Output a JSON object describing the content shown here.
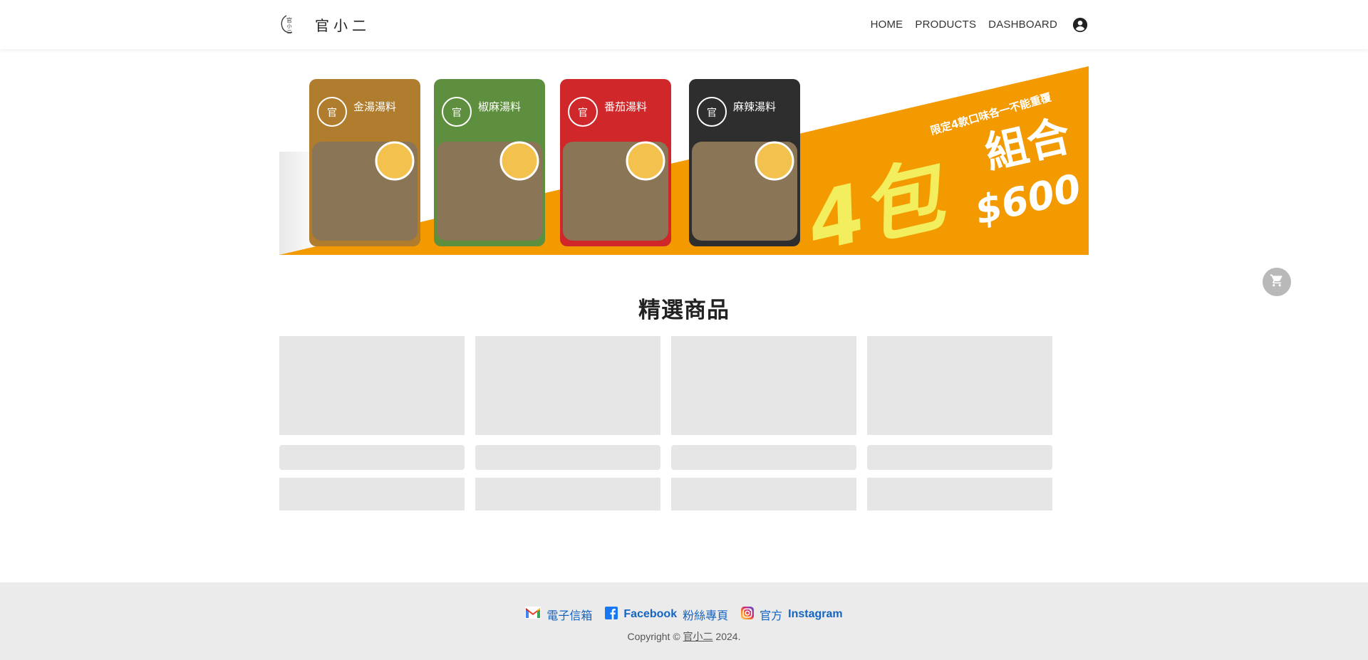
{
  "header": {
    "brand_name": "官小二",
    "nav": [
      "HOME",
      "PRODUCTS",
      "DASHBOARD"
    ],
    "icons": {
      "logo": "brand-logo-icon",
      "account": "account-circle-icon"
    }
  },
  "banner": {
    "products": [
      {
        "name": "金湯湯料",
        "color": "#b07d2e"
      },
      {
        "name": "椒麻湯料",
        "color": "#5e8f3e"
      },
      {
        "name": "番茄湯料",
        "color": "#d0282a"
      },
      {
        "name": "麻辣湯料",
        "color": "#2e2e2e"
      }
    ],
    "tagline": "限定4款口味各一不能重覆",
    "combo_big": "4包",
    "combo_word": "組合",
    "price": "$600",
    "accent_color": "#f29a00",
    "text_color": "#f3ee5e"
  },
  "cart": {
    "icon": "shopping-cart-icon"
  },
  "featured": {
    "title": "精選商品",
    "placeholder_cards": 4
  },
  "footer": {
    "links": [
      {
        "icon": "gmail-icon",
        "text": "電子信箱",
        "bold": ""
      },
      {
        "icon": "facebook-icon",
        "text": "粉絲專頁",
        "bold": "Facebook"
      },
      {
        "icon": "instagram-icon",
        "text": "官方",
        "bold": "Instagram"
      }
    ],
    "copyright_prefix": "Copyright ©",
    "copyright_brand": "官小二",
    "copyright_year": "2024."
  }
}
